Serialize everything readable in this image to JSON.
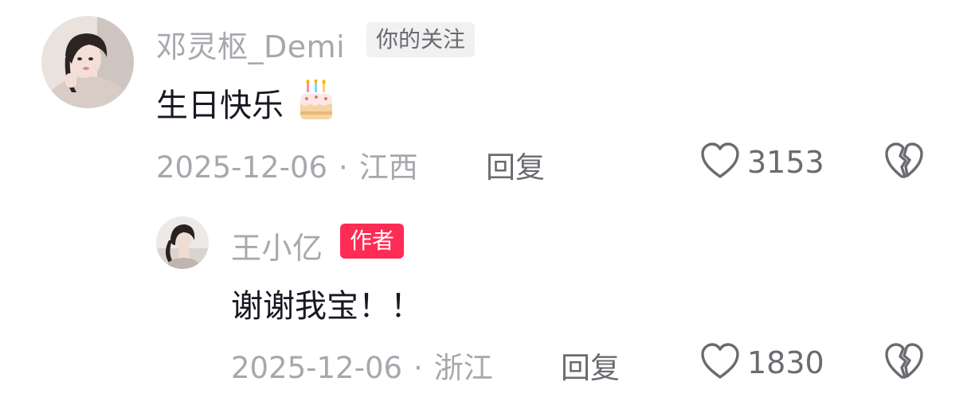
{
  "comments": [
    {
      "username": "邓灵枢_Demi",
      "badge": "你的关注",
      "text": "生日快乐",
      "emoji": "birthday-cake",
      "date": "2025-12-06",
      "separator": "·",
      "location": "江西",
      "reply_label": "回复",
      "likes": "3153"
    },
    {
      "username": "王小亿",
      "badge": "作者",
      "text": "谢谢我宝！！",
      "date": "2025-12-06",
      "separator": "·",
      "location": "浙江",
      "reply_label": "回复",
      "likes": "1830"
    }
  ],
  "colors": {
    "author_badge": "#fe2c55",
    "follow_badge_bg": "#f1f1f2",
    "meta_text": "#a7a8ad",
    "primary_text": "#161823"
  },
  "icons": [
    "heart-outline-icon",
    "broken-heart-icon",
    "birthday-cake-emoji"
  ]
}
